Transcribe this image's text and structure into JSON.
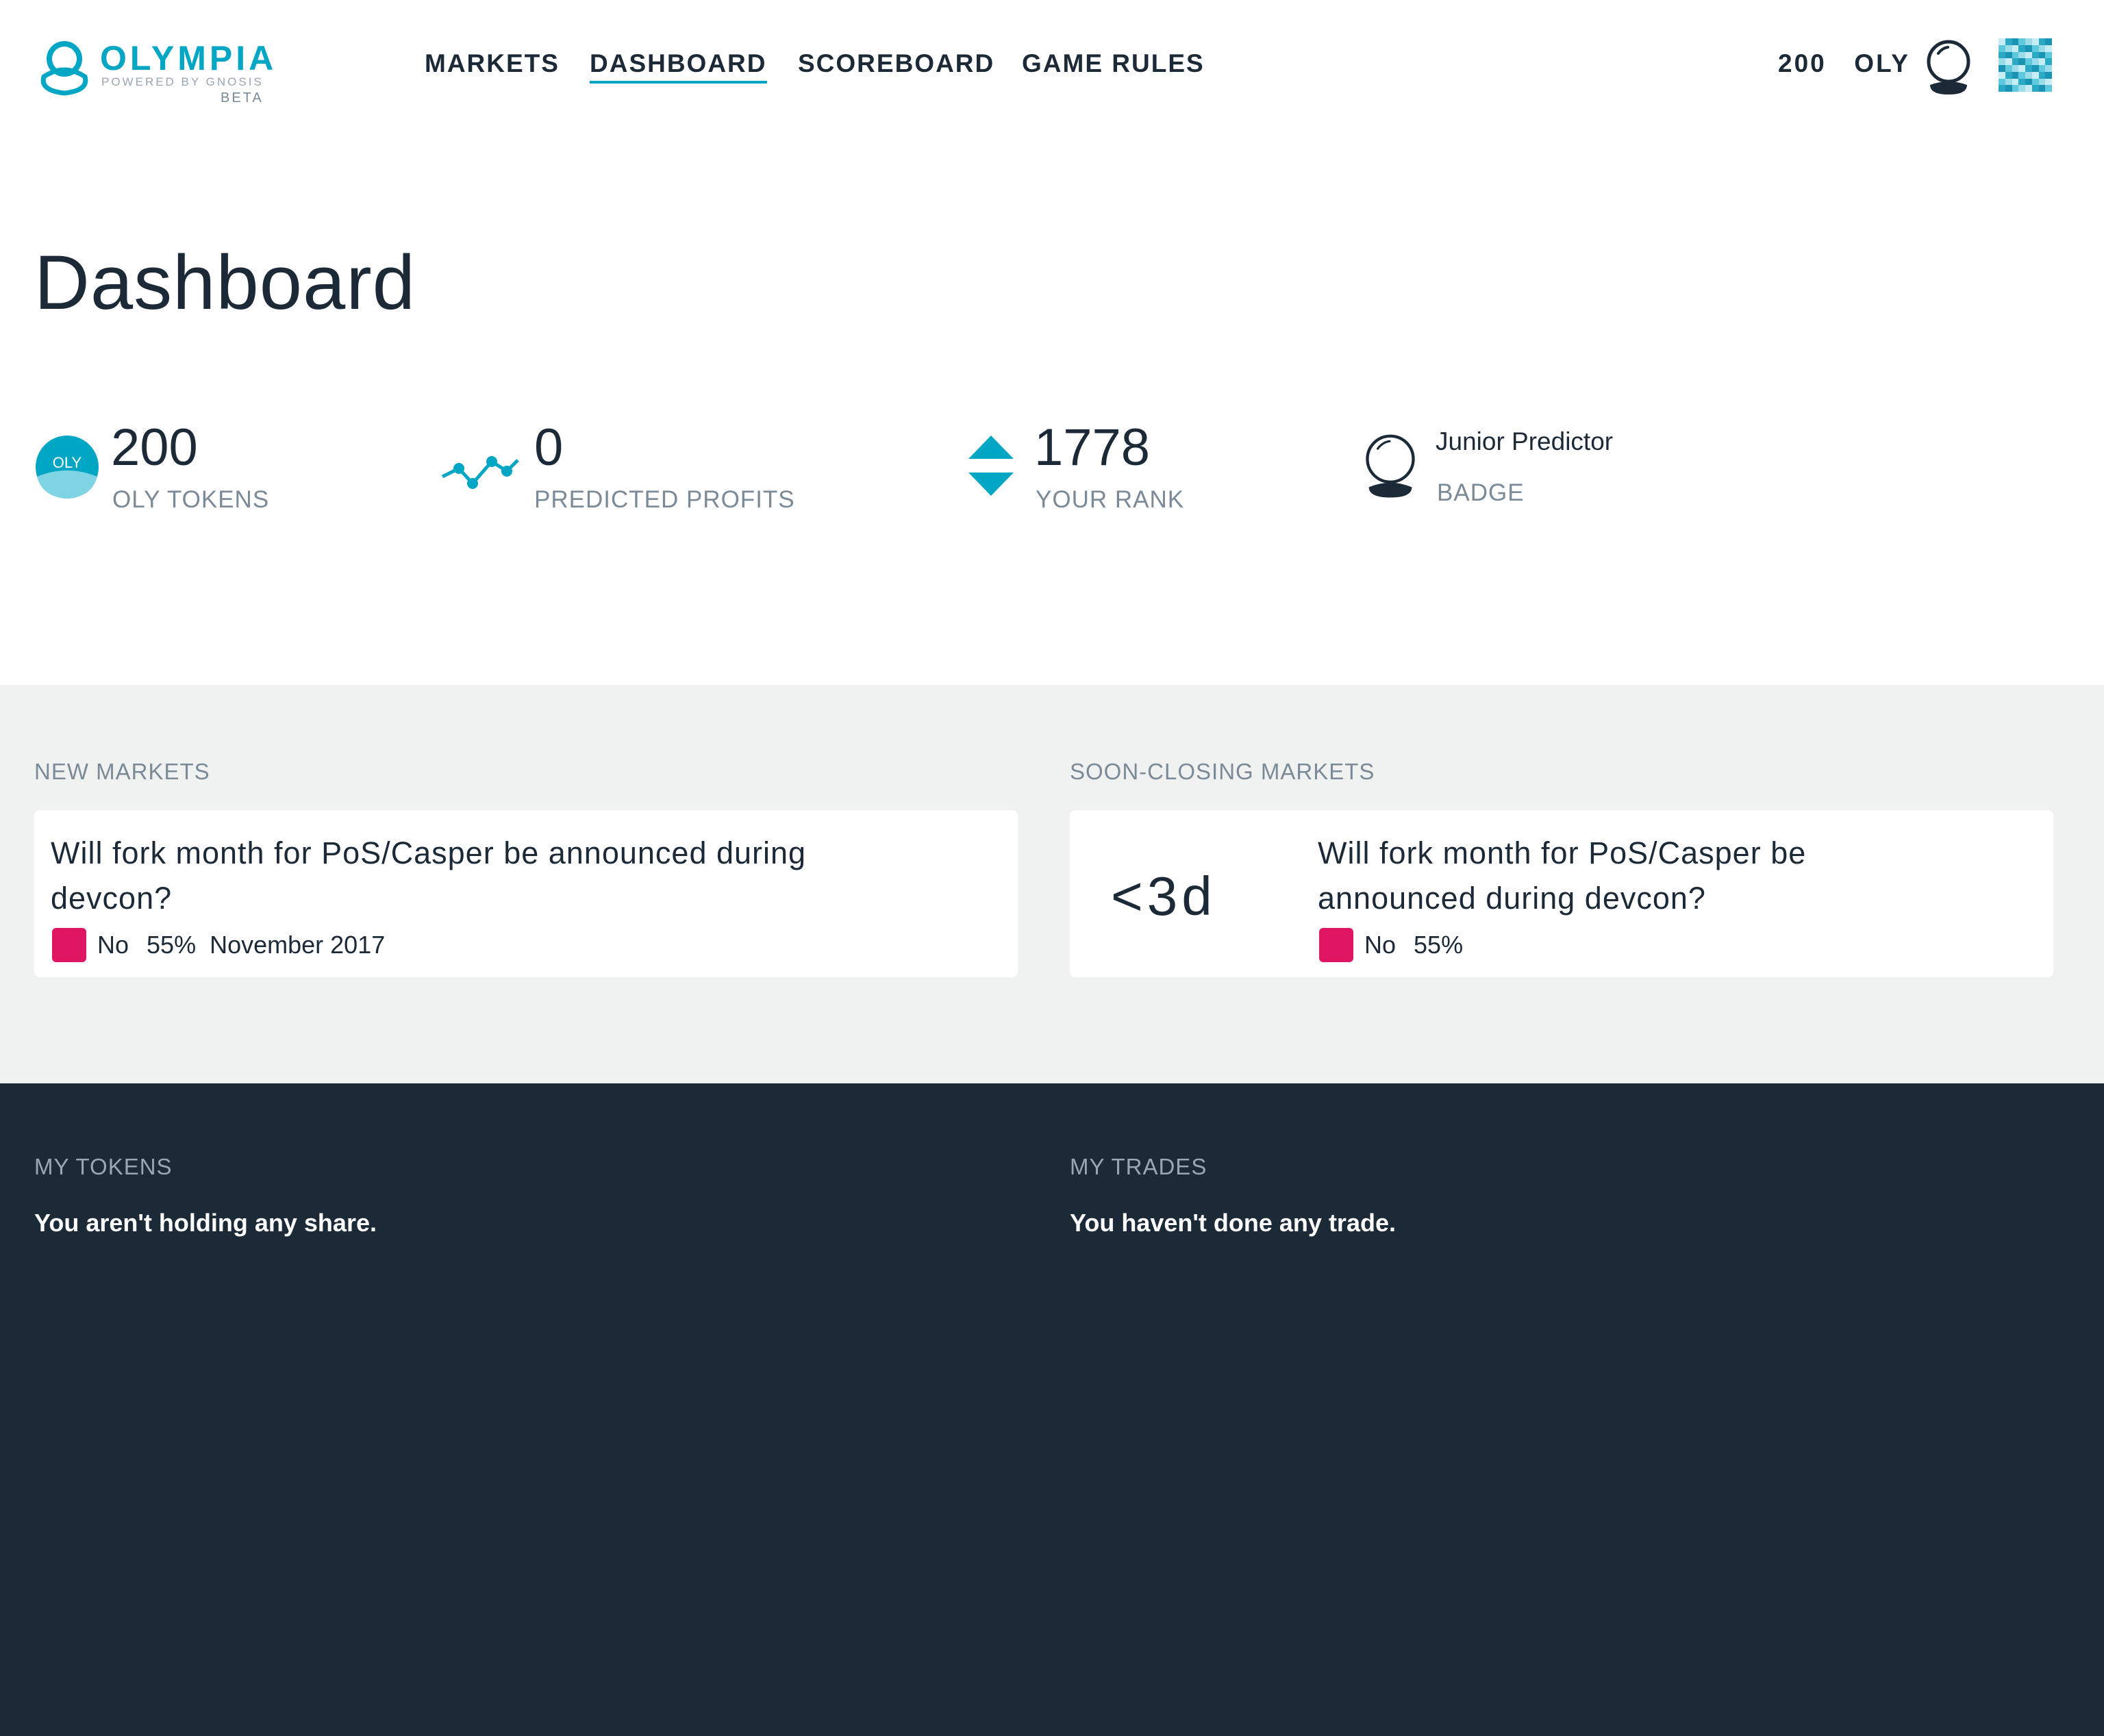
{
  "brand": {
    "name": "OLYMPIA",
    "tagline": "POWERED BY GNOSIS",
    "stage": "BETA",
    "accent": "#00a6c4"
  },
  "nav": {
    "items": [
      {
        "label": "MARKETS",
        "active": false
      },
      {
        "label": "DASHBOARD",
        "active": true
      },
      {
        "label": "SCOREBOARD",
        "active": false
      },
      {
        "label": "GAME RULES",
        "active": false
      }
    ]
  },
  "account": {
    "balance": "200",
    "unit": "OLY",
    "badge_icon": "crystal-ball-icon",
    "avatar_icon": "identicon-avatar"
  },
  "page": {
    "title": "Dashboard"
  },
  "stats": {
    "tokens": {
      "value": "200",
      "label": "OLY TOKENS",
      "icon": "oly-token-icon",
      "icon_text": "OLY"
    },
    "profits": {
      "value": "0",
      "label": "PREDICTED PROFITS",
      "icon": "trend-line-icon"
    },
    "rank": {
      "value": "1778",
      "label": "YOUR RANK",
      "icon": "rank-arrows-icon"
    },
    "badge": {
      "value": "Junior Predictor",
      "label": "BADGE",
      "icon": "crystal-ball-icon"
    }
  },
  "new_markets": {
    "title": "NEW MARKETS",
    "card": {
      "question_line1": "Will fork month for PoS/Casper be announced during",
      "question_line2": "devcon?",
      "outcome": "No",
      "probability": "55%",
      "resolution": "November 2017",
      "outcome_color": "#e01563"
    }
  },
  "closing_markets": {
    "title": "SOON-CLOSING MARKETS",
    "card": {
      "countdown": "<3d",
      "question_line1": "Will fork month for PoS/Casper be",
      "question_line2": "announced during devcon?",
      "outcome": "No",
      "probability": "55%",
      "outcome_color": "#e01563"
    }
  },
  "my_tokens": {
    "title": "MY TOKENS",
    "empty": "You aren't holding any share."
  },
  "my_trades": {
    "title": "MY TRADES",
    "empty": "You haven't done any trade."
  }
}
